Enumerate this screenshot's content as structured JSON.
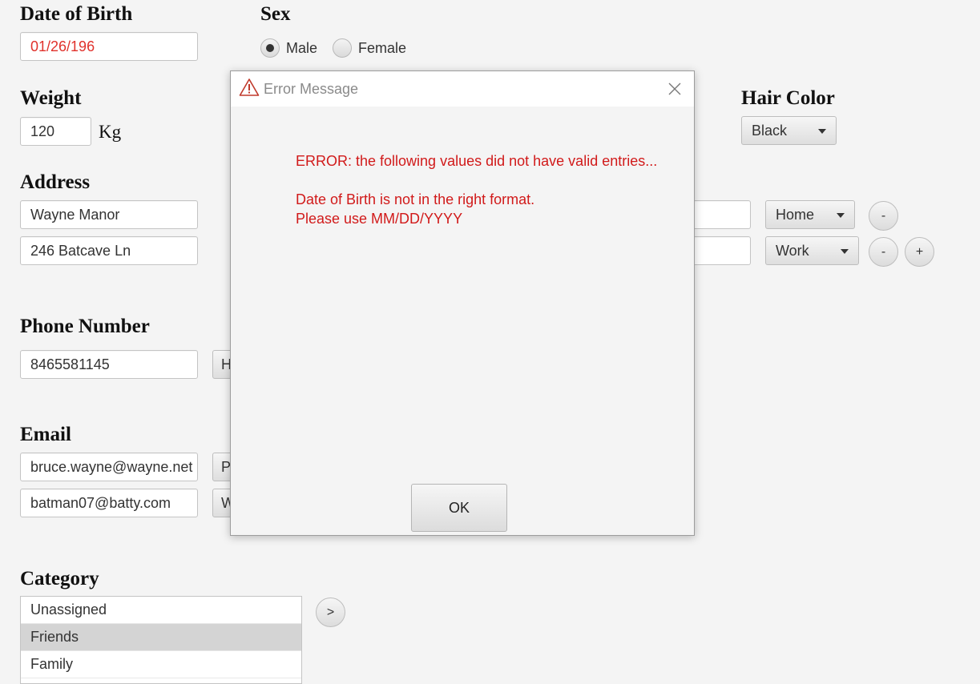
{
  "form": {
    "dob_label": "Date of Birth",
    "dob_value": "01/26/196",
    "sex_label": "Sex",
    "sex_options": [
      "Male",
      "Female"
    ],
    "sex_selected": "Male",
    "weight_label": "Weight",
    "weight_value": "120",
    "weight_unit": "Kg",
    "hair_label": "Hair Color",
    "hair_value": "Black",
    "address_label": "Address",
    "address_lines": [
      "Wayne Manor",
      "246 Batcave Ln"
    ],
    "address_types": [
      "Home",
      "Work"
    ],
    "remove_label": "-",
    "add_label": "+",
    "phone_label": "Phone Number",
    "phone_value": "8465581145",
    "phone_type_partial": "H",
    "email_label": "Email",
    "emails": [
      "bruce.wayne@wayne.net",
      "batman07@batty.com"
    ],
    "email_types_partial": [
      "P",
      "W"
    ],
    "category_label": "Category",
    "categories": [
      "Unassigned",
      "Friends",
      "Family"
    ],
    "category_selected": "Friends",
    "move_label": ">"
  },
  "dialog": {
    "title": "Error Message",
    "line1": "ERROR: the following values did not have valid entries...",
    "line2": "Date of Birth is not in the right format.",
    "line3": "Please use MM/DD/YYYY",
    "ok_label": "OK",
    "icon": "warning-triangle-icon",
    "close_icon": "close-icon"
  },
  "colors": {
    "error_text": "#d11a1a",
    "invalid_field_text": "#e0312b",
    "background": "#f4f4f4"
  }
}
